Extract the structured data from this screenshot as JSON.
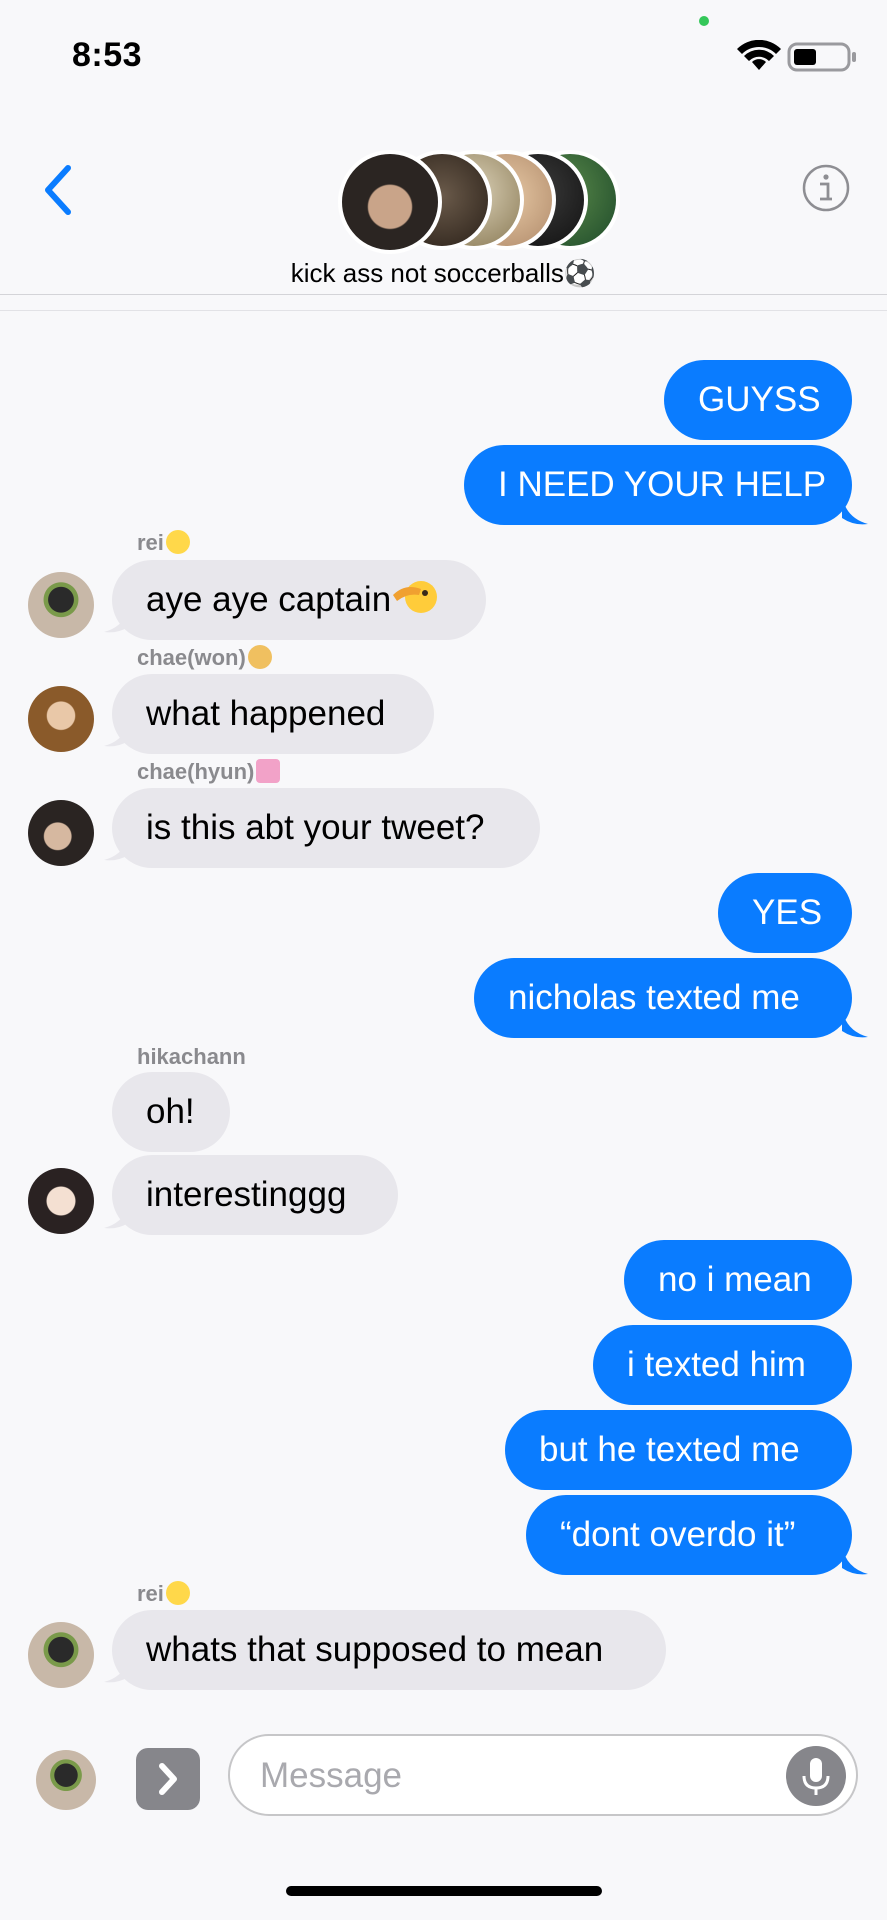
{
  "status_bar": {
    "time": "8:53"
  },
  "header": {
    "group_name": "kick ass not soccerballs⚽"
  },
  "messages": {
    "m1": "GUYSS",
    "m2": "I NEED YOUR HELP",
    "s3": "rei",
    "m3": "aye aye captain",
    "s4": "chae(won)",
    "m4": "what happened",
    "s5": "chae(hyun)",
    "m5": "is this abt your tweet?",
    "m6": "YES",
    "m7": "nicholas texted me",
    "s8": "hikachann",
    "m8": "oh!",
    "m9": "interestinggg",
    "m10": "no i mean",
    "m11": "i texted him",
    "m12": "but he texted me",
    "m13": "“dont overdo it”",
    "s14": "rei",
    "m14": "whats that supposed to mean"
  },
  "composer": {
    "placeholder": "Message"
  },
  "colors": {
    "accent": "#0a7cff",
    "incoming": "#e8e7ec",
    "sender": "#8a8a8e"
  },
  "icons": {
    "back": "chevron-left-icon",
    "info": "info-icon",
    "apps": "chevron-right-icon",
    "mic": "microphone-icon",
    "wifi": "wifi-icon",
    "battery": "battery-icon"
  }
}
